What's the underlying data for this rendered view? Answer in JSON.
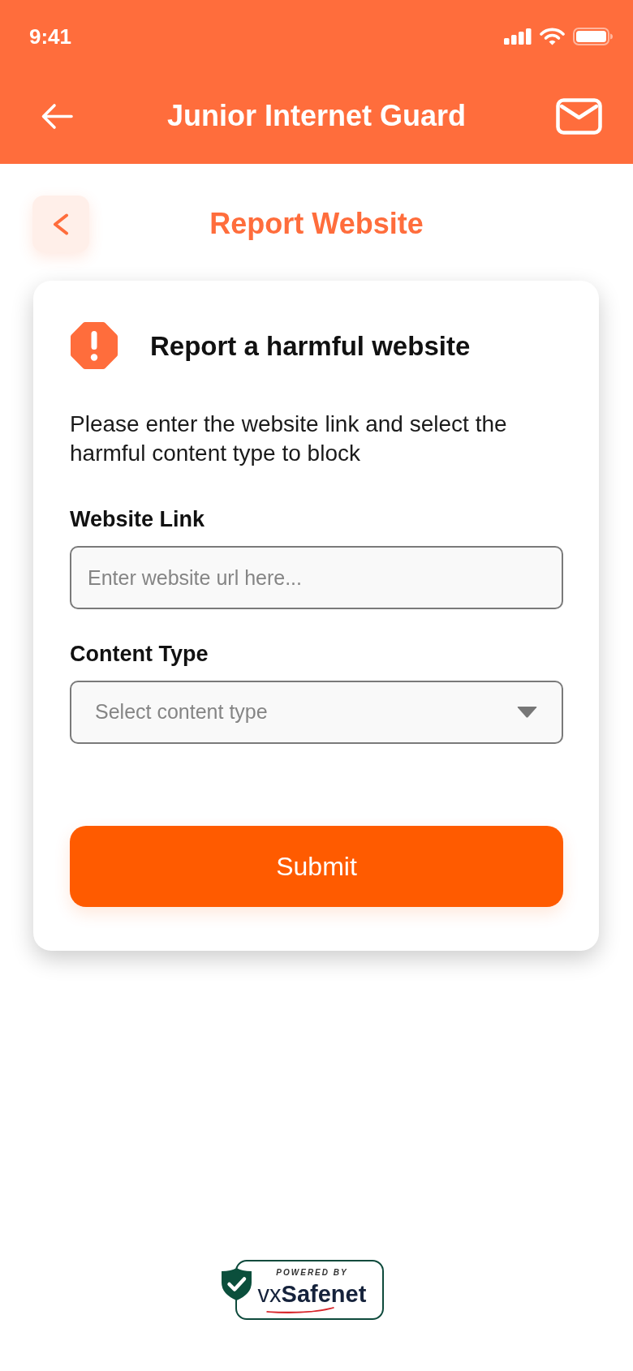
{
  "status_bar": {
    "time": "9:41"
  },
  "app_bar": {
    "title": "Junior Internet Guard"
  },
  "page_header": {
    "title": "Report Website"
  },
  "report_card": {
    "heading": "Report a harmful website",
    "description": "Please enter the website link and select the harmful content type to block",
    "fields": [
      {
        "kind": "text",
        "label": "Website Link",
        "placeholder": "Enter website url here..."
      },
      {
        "kind": "select",
        "label": "Content Type",
        "placeholder": "Select content type"
      }
    ],
    "submit_button": "Submit"
  },
  "footer": {
    "badge_caption": "POWERED BY",
    "brand": "vx**Safenet**"
  }
}
